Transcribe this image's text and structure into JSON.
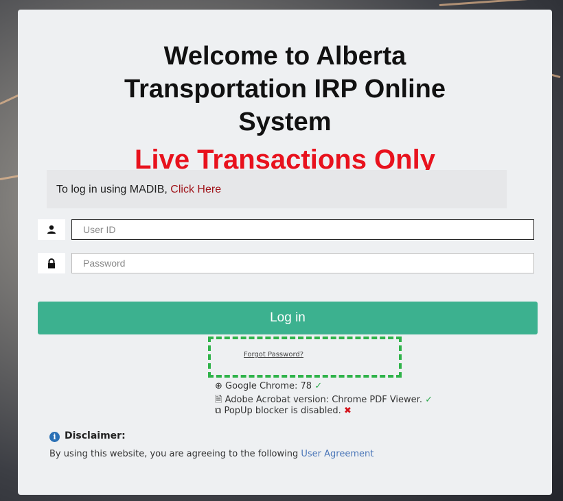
{
  "header": {
    "title_line1": "Welcome to Alberta",
    "title_line2": "Transportation IRP Online",
    "title_line3": "System",
    "live_banner": "Live Transactions Only"
  },
  "madib": {
    "prefix": "To log in using MADIB, ",
    "link": "Click Here"
  },
  "login": {
    "userid_placeholder": "User ID",
    "password_placeholder": "Password",
    "button": "Log in",
    "forgot": "Forgot Password?"
  },
  "environment": [
    {
      "icon": "globe-icon",
      "text": "Google Chrome: 78",
      "status": "ok"
    },
    {
      "icon": "pdf-file-icon",
      "text": "Adobe Acrobat version: Chrome PDF Viewer.",
      "status": "ok"
    },
    {
      "icon": "external-link-icon",
      "text": "PopUp blocker is disabled.",
      "status": "bad"
    }
  ],
  "disclaimer": {
    "title": "Disclaimer:",
    "text": "By using this website, you are agreeing to the following ",
    "link": "User Agreement"
  },
  "colors": {
    "primary_button": "#3cb18f",
    "live_red": "#e8121d",
    "link_red": "#a0141a",
    "link_blue": "#4a76b8",
    "highlight_green": "#2fb34a"
  }
}
